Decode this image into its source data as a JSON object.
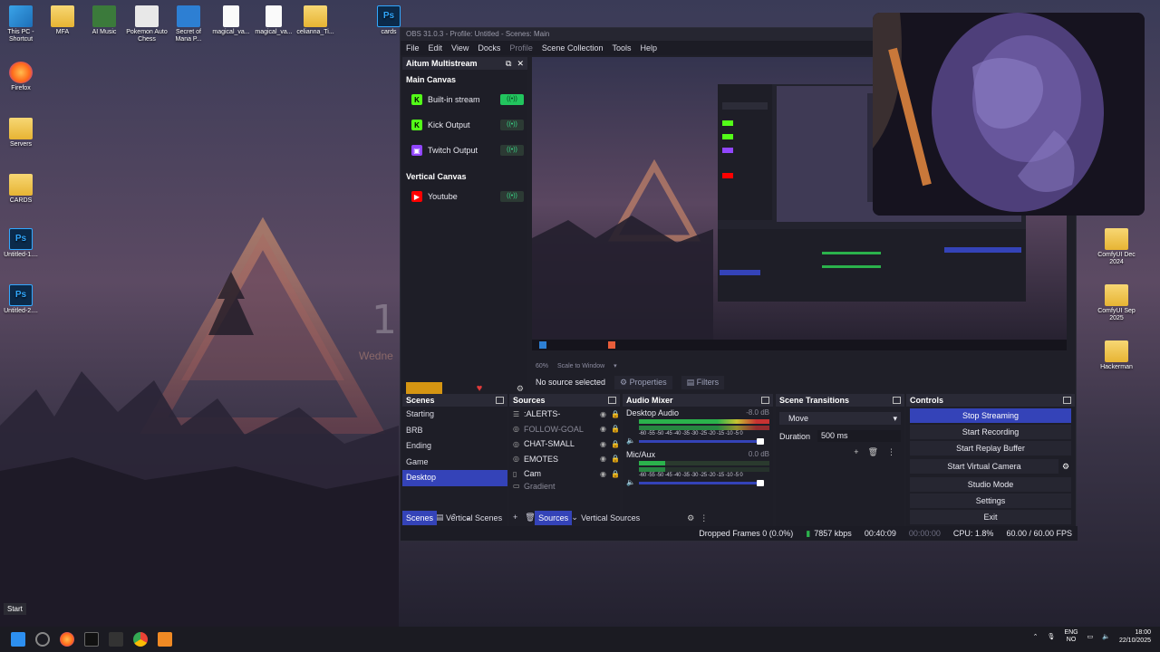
{
  "desktop": {
    "left_icons": [
      {
        "label": "This PC - Shortcut",
        "icon": "computer-icon"
      },
      {
        "label": "Firefox",
        "icon": "firefox-icon"
      },
      {
        "label": "Servers",
        "icon": "folder-icon"
      },
      {
        "label": "CARDS",
        "icon": "folder-icon"
      },
      {
        "label": "Untitled-1....",
        "icon": "photoshop-file-icon"
      },
      {
        "label": "Untitled-2....",
        "icon": "photoshop-file-icon"
      }
    ],
    "top_icons": [
      {
        "label": "MFA",
        "icon": "folder-icon"
      },
      {
        "label": "AI Music",
        "icon": "app-icon"
      },
      {
        "label": "Pokemon Auto Chess",
        "icon": "game-icon"
      },
      {
        "label": "Secret of Mana P...",
        "icon": "game-icon"
      },
      {
        "label": "magical_va...",
        "icon": "file-icon"
      },
      {
        "label": "magical_va...",
        "icon": "file-icon"
      },
      {
        "label": "celianna_Ti...",
        "icon": "folder-icon"
      },
      {
        "label": "cards",
        "icon": "photoshop-file-icon"
      }
    ],
    "right_icons": [
      {
        "label": "ComfyUI Dec 2024",
        "icon": "folder-icon"
      },
      {
        "label": "ComfyUI Sep 2025",
        "icon": "folder-icon"
      },
      {
        "label": "Hackerman",
        "icon": "folder-icon"
      }
    ],
    "wallpaper_clock": "1",
    "wallpaper_day": "Wedne"
  },
  "obs": {
    "title": "OBS 31.0.3 - Profile: Untitled - Scenes: Main",
    "menu": [
      "File",
      "Edit",
      "View",
      "Docks",
      "Profile",
      "Scene Collection",
      "Tools",
      "Help"
    ],
    "multistream": {
      "title": "Aitum Multistream",
      "main_canvas_label": "Main Canvas",
      "main_outputs": [
        {
          "label": "Built-in stream",
          "platform": "kick",
          "color": "#53fc18",
          "on": true
        },
        {
          "label": "Kick Output",
          "platform": "kick",
          "color": "#53fc18",
          "on": false
        },
        {
          "label": "Twitch Output",
          "platform": "twitch",
          "color": "#9146ff",
          "on": false
        }
      ],
      "vertical_canvas_label": "Vertical Canvas",
      "vertical_outputs": [
        {
          "label": "Youtube",
          "platform": "youtube",
          "color": "#ff0000",
          "on": false
        }
      ]
    },
    "preview": {
      "zoom": "60%",
      "scale_label": "Scale to Window"
    },
    "source_bar": {
      "status": "No source selected",
      "properties": "Properties",
      "filters": "Filters"
    },
    "scenes": {
      "title": "Scenes",
      "items": [
        "Starting",
        "BRB",
        "Ending",
        "Game",
        "Desktop"
      ],
      "selected": "Desktop"
    },
    "sources": {
      "title": "Sources",
      "items": [
        {
          "label": ":ALERTS-",
          "dim": false
        },
        {
          "label": "FOLLOW-GOAL",
          "dim": true
        },
        {
          "label": "CHAT-SMALL",
          "dim": false
        },
        {
          "label": "EMOTES",
          "dim": false
        },
        {
          "label": "Cam",
          "dim": false
        },
        {
          "label": "Gradient",
          "dim": true
        }
      ]
    },
    "mixer": {
      "title": "Audio Mixer",
      "channels": [
        {
          "name": "Desktop Audio",
          "db": "-8.0 dB",
          "level": 0.62
        },
        {
          "name": "Mic/Aux",
          "db": "0.0 dB",
          "level": 0.2
        }
      ],
      "scale": "-60 -55 -50 -45 -40 -35 -30 -25 -20 -15 -10 -5 0"
    },
    "transitions": {
      "title": "Scene Transitions",
      "selected": "Move",
      "duration_label": "Duration",
      "duration_value": "500 ms"
    },
    "controls": {
      "title": "Controls",
      "stop_streaming": "Stop Streaming",
      "start_recording": "Start Recording",
      "start_replay": "Start Replay Buffer",
      "start_virtual_camera": "Start Virtual Camera",
      "studio_mode": "Studio Mode",
      "settings": "Settings",
      "exit": "Exit"
    },
    "bottom_tabs": [
      "Scenes",
      "Vertical Scenes",
      "Sources",
      "Vertical Sources"
    ],
    "status": {
      "dropped_frames": "Dropped Frames 0 (0.0%)",
      "bitrate": "7857 kbps",
      "stream_time": "00:40:09",
      "record_time": "00:00:00",
      "cpu": "CPU: 1.8%",
      "fps": "60.00 / 60.00 FPS"
    }
  },
  "taskbar": {
    "start_tooltip": "Start",
    "lang_top": "ENG",
    "lang_bottom": "NO",
    "time": "18:00",
    "date": "22/10/2025"
  }
}
